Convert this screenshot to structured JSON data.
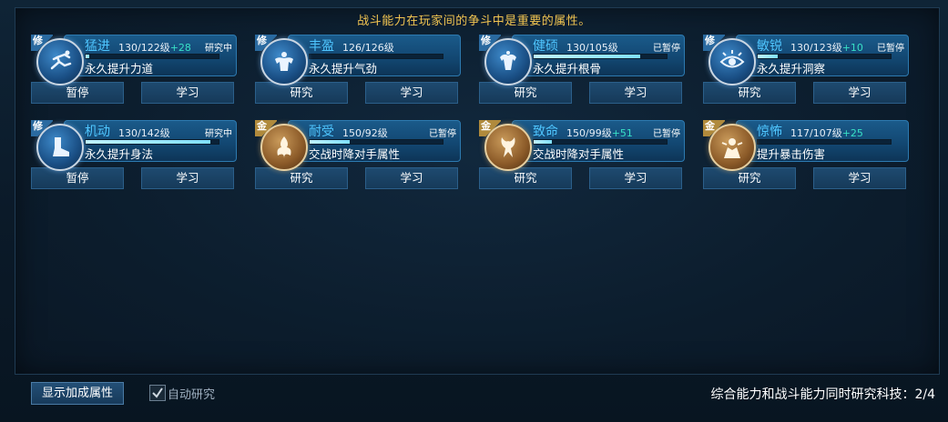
{
  "notice": "战斗能力在玩家间的争斗中是重要的属性。",
  "cards": [
    {
      "badge": "修",
      "badge_color": "blue",
      "name": "猛进",
      "level": "130/122级",
      "bonus": "+28",
      "status": "研究中",
      "progress": 0.03,
      "desc": "永久提升力道",
      "btn1": "暂停",
      "btn2": "学习",
      "icon": "sprint-icon"
    },
    {
      "badge": "修",
      "badge_color": "blue",
      "name": "丰盈",
      "level": "126/126级",
      "bonus": "",
      "status": "",
      "progress": 0,
      "desc": "永久提升气劲",
      "btn1": "研究",
      "btn2": "学习",
      "icon": "strength-icon"
    },
    {
      "badge": "修",
      "badge_color": "blue",
      "name": "健硕",
      "level": "130/105级",
      "bonus": "",
      "status": "已暂停",
      "progress": 0.8,
      "desc": "永久提升根骨",
      "btn1": "研究",
      "btn2": "学习",
      "icon": "muscle-icon"
    },
    {
      "badge": "修",
      "badge_color": "blue",
      "name": "敏锐",
      "level": "130/123级",
      "bonus": "+10",
      "status": "已暂停",
      "progress": 0.15,
      "desc": "永久提升洞察",
      "btn1": "研究",
      "btn2": "学习",
      "icon": "eye-icon"
    },
    {
      "badge": "修",
      "badge_color": "blue",
      "name": "机动",
      "level": "130/142级",
      "bonus": "",
      "status": "研究中",
      "progress": 0.94,
      "desc": "永久提升身法",
      "btn1": "暂停",
      "btn2": "学习",
      "icon": "boot-icon"
    },
    {
      "badge": "金",
      "badge_color": "gold",
      "name": "耐受",
      "level": "150/92级",
      "bonus": "",
      "status": "已暂停",
      "progress": 0.3,
      "desc": "交战时降对手属性",
      "btn1": "研究",
      "btn2": "学习",
      "icon": "spirit-icon"
    },
    {
      "badge": "金",
      "badge_color": "gold",
      "name": "致命",
      "level": "150/99级",
      "bonus": "+51",
      "status": "已暂停",
      "progress": 0.14,
      "desc": "交战时降对手属性",
      "btn1": "研究",
      "btn2": "学习",
      "icon": "flame-icon"
    },
    {
      "badge": "金",
      "badge_color": "gold",
      "name": "惊怖",
      "level": "117/107级",
      "bonus": "+25",
      "status": "",
      "progress": 0,
      "desc": "提升暴击伤害",
      "btn1": "研究",
      "btn2": "学习",
      "icon": "fear-icon"
    }
  ],
  "bottom": {
    "show_bonus_label": "显示加成属性",
    "auto_research_label": "自动研究",
    "auto_research_checked": true,
    "footer_text": "综合能力和战斗能力同时研究科技：2/4"
  },
  "colors": {
    "accent": "#4fc6ff",
    "notice": "#f2c451",
    "bonus": "#38e0c6",
    "gold_badge": "#b08a3c",
    "blue_badge": "#2a6aa0"
  }
}
